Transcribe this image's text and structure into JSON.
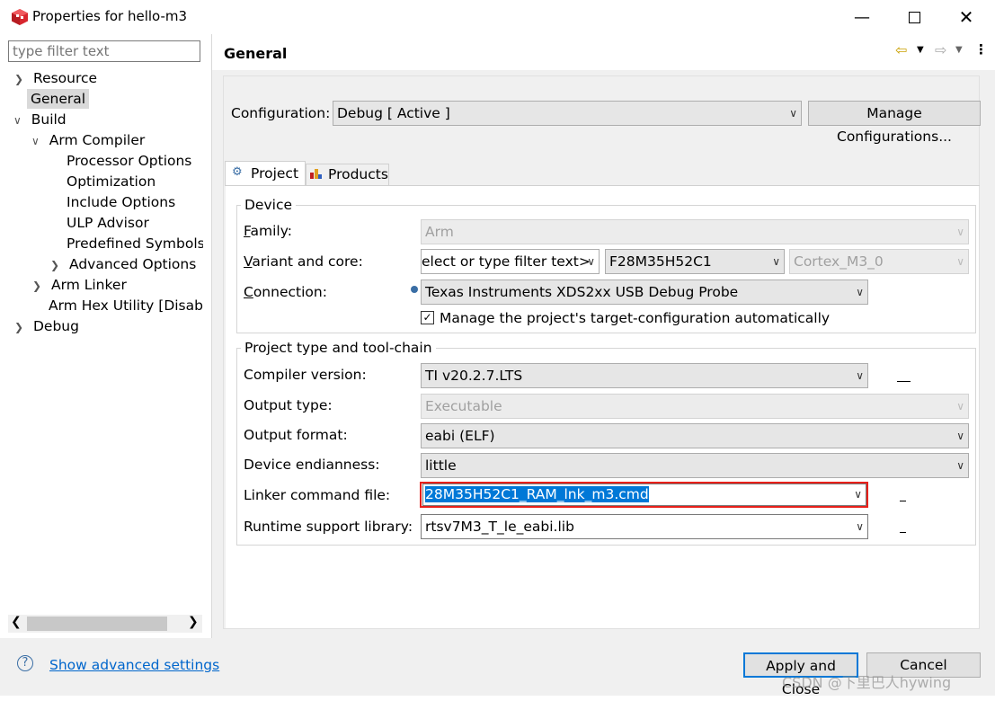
{
  "window": {
    "title": "Properties for hello-m3"
  },
  "colors": {
    "highlight_border": "#e8201a",
    "selection": "#0078d7",
    "link": "#0066cc"
  },
  "filter": {
    "placeholder": "type filter text"
  },
  "tree": [
    {
      "label": "Resource"
    },
    {
      "label": "General",
      "selected": true
    },
    {
      "label": "Build"
    },
    {
      "label": "Arm Compiler"
    },
    {
      "label": "Processor Options"
    },
    {
      "label": "Optimization"
    },
    {
      "label": "Include Options"
    },
    {
      "label": "ULP Advisor"
    },
    {
      "label": "Predefined Symbols"
    },
    {
      "label": "Advanced Options"
    },
    {
      "label": "Arm Linker"
    },
    {
      "label": "Arm Hex Utility  [Disabled]"
    },
    {
      "label": "Debug"
    }
  ],
  "page": {
    "title": "General"
  },
  "configuration": {
    "label": "Configuration:",
    "value": "Debug  [ Active ]",
    "manage_button": "Manage Configurations..."
  },
  "tabs": {
    "project": "Project",
    "products": "Products"
  },
  "device": {
    "group_title": "Device",
    "family_label": "Family:",
    "family_value": "Arm",
    "variant_label": "Variant and core:",
    "variant_filter": "elect or type filter text>",
    "variant_value": "F28M35H52C1",
    "core_value": "Cortex_M3_0",
    "connection_label": "Connection:",
    "connection_value": "Texas Instruments XDS2xx USB Debug Probe",
    "manage_checkbox": "Manage the project's target-configuration automatically"
  },
  "toolchain": {
    "group_title": "Project type and tool-chain",
    "compiler_label": "Compiler version:",
    "compiler_value": "TI v20.2.7.LTS",
    "output_type_label": "Output type:",
    "output_type_value": "Executable",
    "output_format_label": "Output format:",
    "output_format_value": "eabi (ELF)",
    "endianness_label": "Device endianness:",
    "endianness_value": "little",
    "linker_label": "Linker command file:",
    "linker_value": "28M35H52C1_RAM_lnk_m3.cmd",
    "runtime_label": "Runtime support library:",
    "runtime_value": "rtsv7M3_T_le_eabi.lib"
  },
  "footer": {
    "advanced_link": "Show advanced settings",
    "apply_close": "Apply and Close",
    "cancel": "Cancel",
    "watermark": "CSDN @下里巴人hywing"
  }
}
